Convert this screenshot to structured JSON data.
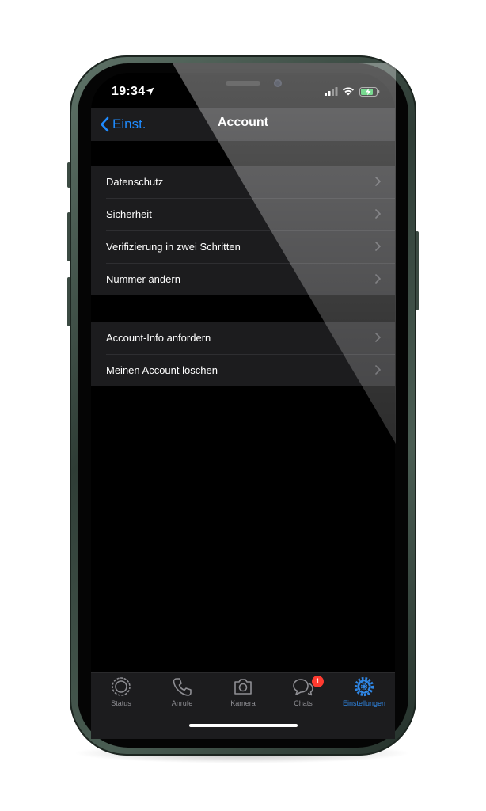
{
  "status_bar": {
    "time": "19:34"
  },
  "navbar": {
    "back_label": "Einst.",
    "title": "Account"
  },
  "groups": [
    {
      "items": [
        {
          "label": "Datenschutz"
        },
        {
          "label": "Sicherheit"
        },
        {
          "label": "Verifizierung in zwei Schritten"
        },
        {
          "label": "Nummer ändern"
        }
      ]
    },
    {
      "items": [
        {
          "label": "Account-Info anfordern"
        },
        {
          "label": "Meinen Account löschen"
        }
      ]
    }
  ],
  "tabbar": {
    "tabs": [
      {
        "label": "Status",
        "icon": "status-icon",
        "active": false
      },
      {
        "label": "Anrufe",
        "icon": "phone-icon",
        "active": false
      },
      {
        "label": "Kamera",
        "icon": "camera-icon",
        "active": false
      },
      {
        "label": "Chats",
        "icon": "chat-bubbles-icon",
        "active": false,
        "badge": "1"
      },
      {
        "label": "Einstellungen",
        "icon": "gear-icon",
        "active": true
      }
    ]
  },
  "colors": {
    "accent": "#1f8bff",
    "active_tab": "#2f87e6",
    "badge": "#ff3b30",
    "cell_background": "#1c1c1e",
    "screen_background": "#000000"
  }
}
